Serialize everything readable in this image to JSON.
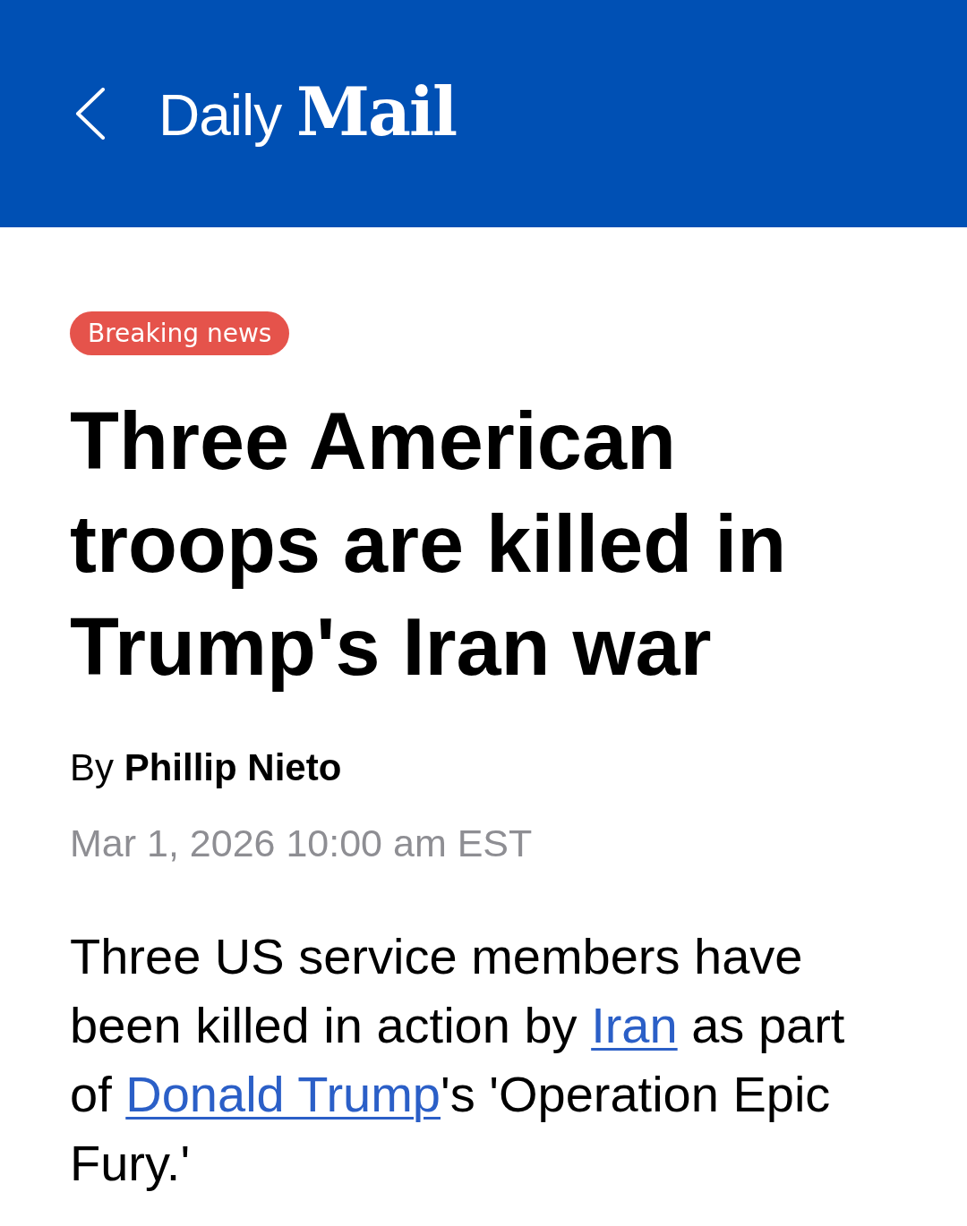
{
  "header": {
    "logo": "Daily **Mail**"
  },
  "article": {
    "badge": "Breaking news",
    "headline": "Three American troops are killed in Trump's Iran war",
    "byline": "By **Phillip Nieto**",
    "date": "Mar 1, 2026 10:00 am EST",
    "body": [
      {
        "kind": "text",
        "text": "Three US service members have been killed in action by "
      },
      {
        "kind": "link",
        "text": "Iran"
      },
      {
        "kind": "text",
        "text": " as part of "
      },
      {
        "kind": "link",
        "text": "Donald Trump"
      },
      {
        "kind": "text",
        "text": "'s 'Operation Epic Fury.'"
      }
    ]
  }
}
